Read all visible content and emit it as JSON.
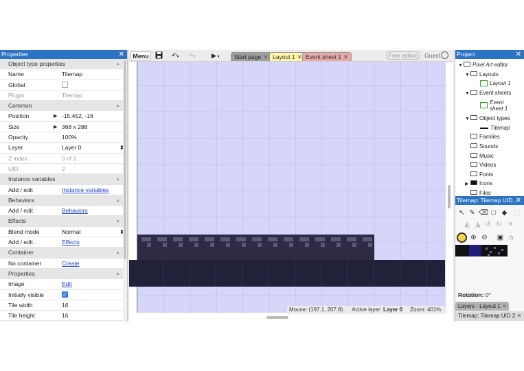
{
  "properties_panel": {
    "title": "Properties",
    "rows": [
      {
        "type": "section",
        "label": "Object type properties"
      },
      {
        "type": "row",
        "key": "Name",
        "value": "Tilemap"
      },
      {
        "type": "checkbox",
        "key": "Global",
        "checked": false
      },
      {
        "type": "row",
        "key": "Plugin",
        "value": "Tilemap",
        "dim": true
      },
      {
        "type": "section",
        "label": "Common"
      },
      {
        "type": "row",
        "key": "Position",
        "value": "-15.452, -16",
        "expand": true
      },
      {
        "type": "row",
        "key": "Size",
        "value": "368 x 288",
        "expand": true
      },
      {
        "type": "row",
        "key": "Opacity",
        "value": "100%"
      },
      {
        "type": "select",
        "key": "Layer",
        "value": "Layer 0"
      },
      {
        "type": "row",
        "key": "Z index",
        "value": "0 of 1",
        "dim": true
      },
      {
        "type": "row",
        "key": "UID",
        "value": "2",
        "dim": true
      },
      {
        "type": "section",
        "label": "Instance variables"
      },
      {
        "type": "link",
        "key": "Add / edit",
        "value": "Instance variables"
      },
      {
        "type": "section",
        "label": "Behaviors"
      },
      {
        "type": "link",
        "key": "Add / edit",
        "value": "Behaviors"
      },
      {
        "type": "section",
        "label": "Effects"
      },
      {
        "type": "select",
        "key": "Blend mode",
        "value": "Normal"
      },
      {
        "type": "link",
        "key": "Add / edit",
        "value": "Effects"
      },
      {
        "type": "section",
        "label": "Container"
      },
      {
        "type": "link",
        "key": "No container",
        "value": "Create"
      },
      {
        "type": "section",
        "label": "Properties"
      },
      {
        "type": "link",
        "key": "Image",
        "value": "Edit"
      },
      {
        "type": "checkbox",
        "key": "Initially visible",
        "checked": true
      },
      {
        "type": "row",
        "key": "Tile width",
        "value": "16"
      },
      {
        "type": "row",
        "key": "Tile height",
        "value": "16"
      }
    ]
  },
  "toolbar": {
    "menu_label": "Menu",
    "tabs": [
      "Start page",
      "Layout 1",
      "Event sheet 1"
    ],
    "active_tab": "Layout 1",
    "free_edition": "Free edition",
    "guest": "Guest"
  },
  "status_bar": {
    "mouse": "Mouse: (197.1, 207.8)",
    "active_layer_label": "Active layer:",
    "active_layer_value": "Layer 0",
    "zoom": "Zoom: 401%"
  },
  "project_panel": {
    "title": "Project",
    "root": "Pixel Art editor",
    "layouts_label": "Layouts",
    "layout1": "Layout 1",
    "event_sheets_label": "Event sheets",
    "event_sheet1_a": "Event",
    "event_sheet1_b": "sheet 1",
    "object_types_label": "Object types",
    "tilemap_obj": "Tilemap",
    "families": "Families",
    "sounds": "Sounds",
    "music": "Music",
    "videos": "Videos",
    "fonts": "Fonts",
    "icons": "Icons",
    "files": "Files"
  },
  "tilemap_panel": {
    "title": "Tilemap: Tilemap UID...",
    "rotation_label": "Rotation:",
    "rotation_value": "0°"
  },
  "bottom_tabs": {
    "layers": "Layers - Layout 1",
    "tilemap": "Tilemap: Tilemap UID 2"
  },
  "colors": {
    "accent": "#2c73c4",
    "canvas_bg": "#d6d6fb",
    "tile_dark": "#22213a",
    "tab_layout": "#fff6a8",
    "tab_event": "#e6a8a8"
  }
}
